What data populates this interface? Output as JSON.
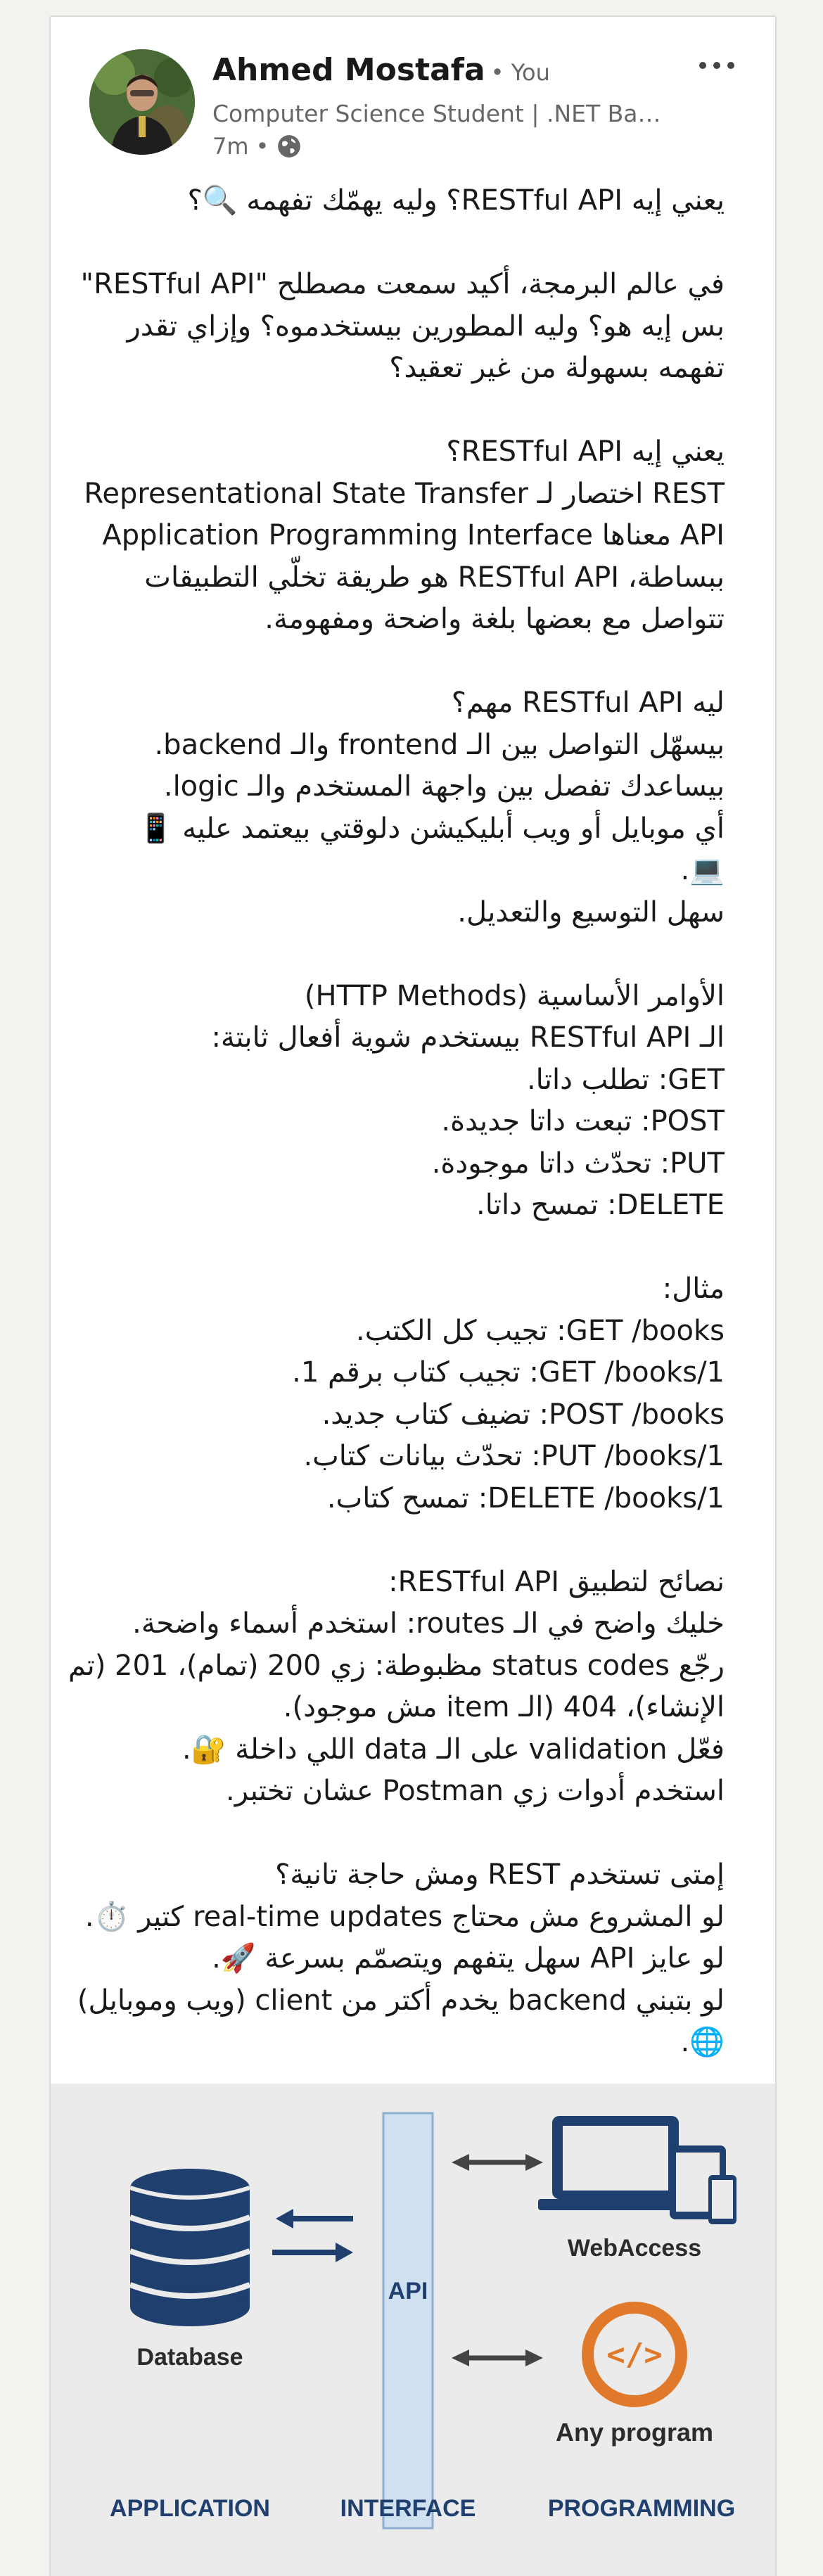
{
  "post": {
    "author_name": "Ahmed Mostafa",
    "you_badge": "• You",
    "headline": "Computer Science Student | .NET Bac...",
    "time": "7m",
    "dot": "•",
    "more_icon": "more-horizontal-icon",
    "visibility_icon": "globe-icon"
  },
  "content": {
    "lines": [
      "يعني إيه RESTful API؟ وليه يهمّك تفهمه 🔍؟",
      "",
      "في عالم البرمجة، أكيد سمعت مصطلح \"RESTful API\"",
      "بس إيه هو؟ وليه المطورين بيستخدموه؟ وإزاي تقدر",
      "تفهمه بسهولة من غير تعقيد؟",
      "",
      "يعني إيه RESTful API؟",
      "REST اختصار لـ Representational State Transfer",
      "API معناها Application Programming Interface",
      "ببساطة، RESTful API هو طريقة تخلّي التطبيقات",
      "تتواصل مع بعضها بلغة واضحة ومفهومة.",
      "",
      "ليه RESTful API مهم؟",
      "بيسهّل التواصل بين الـ frontend والـ backend.",
      "بيساعدك تفصل بين واجهة المستخدم والـ logic.",
      "أي موبايل أو ويب أبليكيشن دلوقتي بيعتمد عليه 📱",
      "💻.",
      "سهل التوسيع والتعديل.",
      "",
      "الأوامر الأساسية (HTTP Methods)",
      "الـ RESTful API بيستخدم شوية أفعال ثابتة:",
      "GET: تطلب داتا.",
      "POST: تبعت داتا جديدة.",
      "PUT: تحدّث داتا موجودة.",
      "DELETE: تمسح داتا.",
      "",
      "مثال:",
      "GET /books: تجيب كل الكتب.",
      "GET /books/1: تجيب كتاب برقم 1.",
      "POST /books: تضيف كتاب جديد.",
      "PUT /books/1: تحدّث بيانات كتاب.",
      "DELETE /books/1: تمسح كتاب.",
      "",
      "نصائح لتطبيق RESTful API:",
      "خليك واضح في الـ routes: استخدم أسماء واضحة.",
      "رجّع status codes مظبوطة: زي 200 (تمام)، 201 (تم",
      "الإنشاء)، 404 (الـ item مش موجود).",
      "فعّل validation على الـ data اللي داخلة 🔐.",
      "استخدم أدوات زي Postman عشان تختبر.",
      "",
      "إمتى تستخدم REST ومش حاجة تانية؟",
      "لو المشروع مش محتاج real-time updates كتير ⏱️.",
      "لو عايز API سهل يتفهم ويتصمّم بسرعة 🚀.",
      "لو بتبني backend يخدم أكتر من client (ويب وموبايل)",
      "🌐."
    ]
  },
  "image": {
    "api_label": "API",
    "webaccess_label": "WebAccess",
    "database_label": "Database",
    "anyprogram_label": "Any program",
    "code_symbol": "</>",
    "bottom_labels": [
      "APPLICATION",
      "INTERFACE",
      "PROGRAMMING"
    ],
    "colors": {
      "database": "#1f3f6e",
      "api_bar": "#cfe0f0",
      "laptop": "#1f3f6e",
      "code_ring": "#e07a2a",
      "arrow": "#1f3f6e"
    }
  }
}
